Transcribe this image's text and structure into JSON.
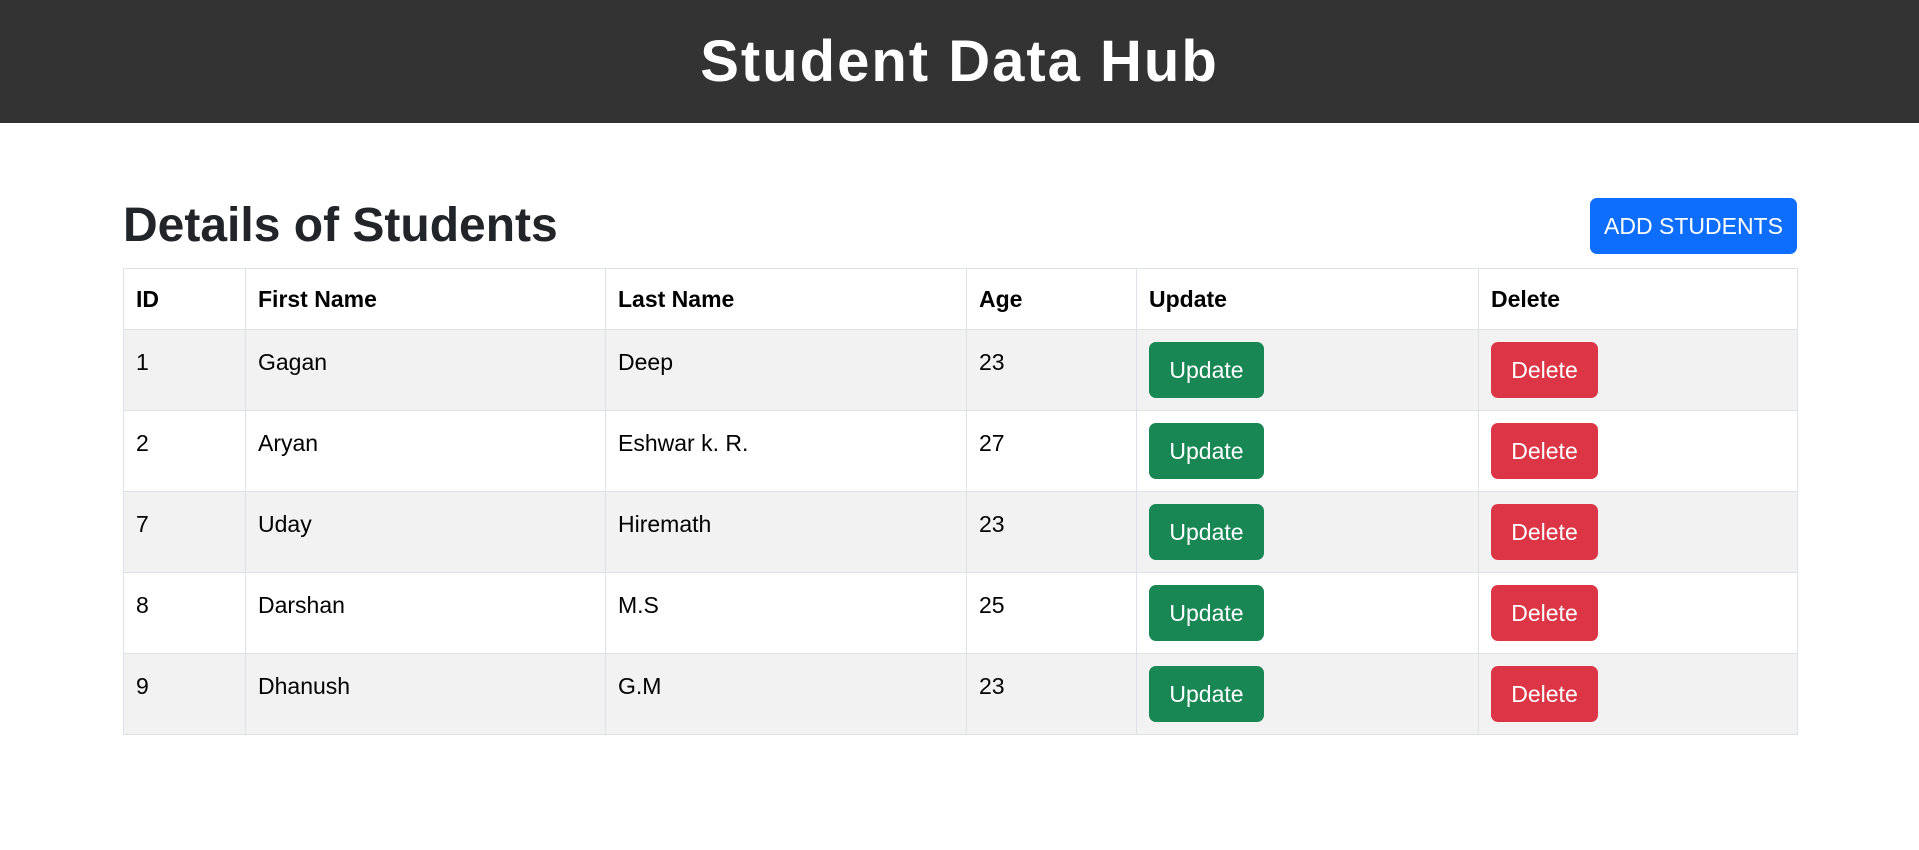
{
  "header": {
    "title": "Student Data Hub"
  },
  "main": {
    "title": "Details of Students",
    "add_button_label": "ADD STUDENTS"
  },
  "table": {
    "columns": [
      "ID",
      "First Name",
      "Last Name",
      "Age",
      "Update",
      "Delete"
    ],
    "rows": [
      {
        "id": "1",
        "first_name": "Gagan",
        "last_name": "Deep",
        "age": "23",
        "update_label": "Update",
        "delete_label": "Delete"
      },
      {
        "id": "2",
        "first_name": "Aryan",
        "last_name": "Eshwar k. R.",
        "age": "27",
        "update_label": "Update",
        "delete_label": "Delete"
      },
      {
        "id": "7",
        "first_name": "Uday",
        "last_name": "Hiremath",
        "age": "23",
        "update_label": "Update",
        "delete_label": "Delete"
      },
      {
        "id": "8",
        "first_name": "Darshan",
        "last_name": "M.S",
        "age": "25",
        "update_label": "Update",
        "delete_label": "Delete"
      },
      {
        "id": "9",
        "first_name": "Dhanush",
        "last_name": "G.M",
        "age": "23",
        "update_label": "Update",
        "delete_label": "Delete"
      }
    ]
  },
  "colors": {
    "header_bg": "#333333",
    "primary": "#0d6efd",
    "success": "#198754",
    "danger": "#dc3545",
    "stripe": "#f2f2f2"
  }
}
